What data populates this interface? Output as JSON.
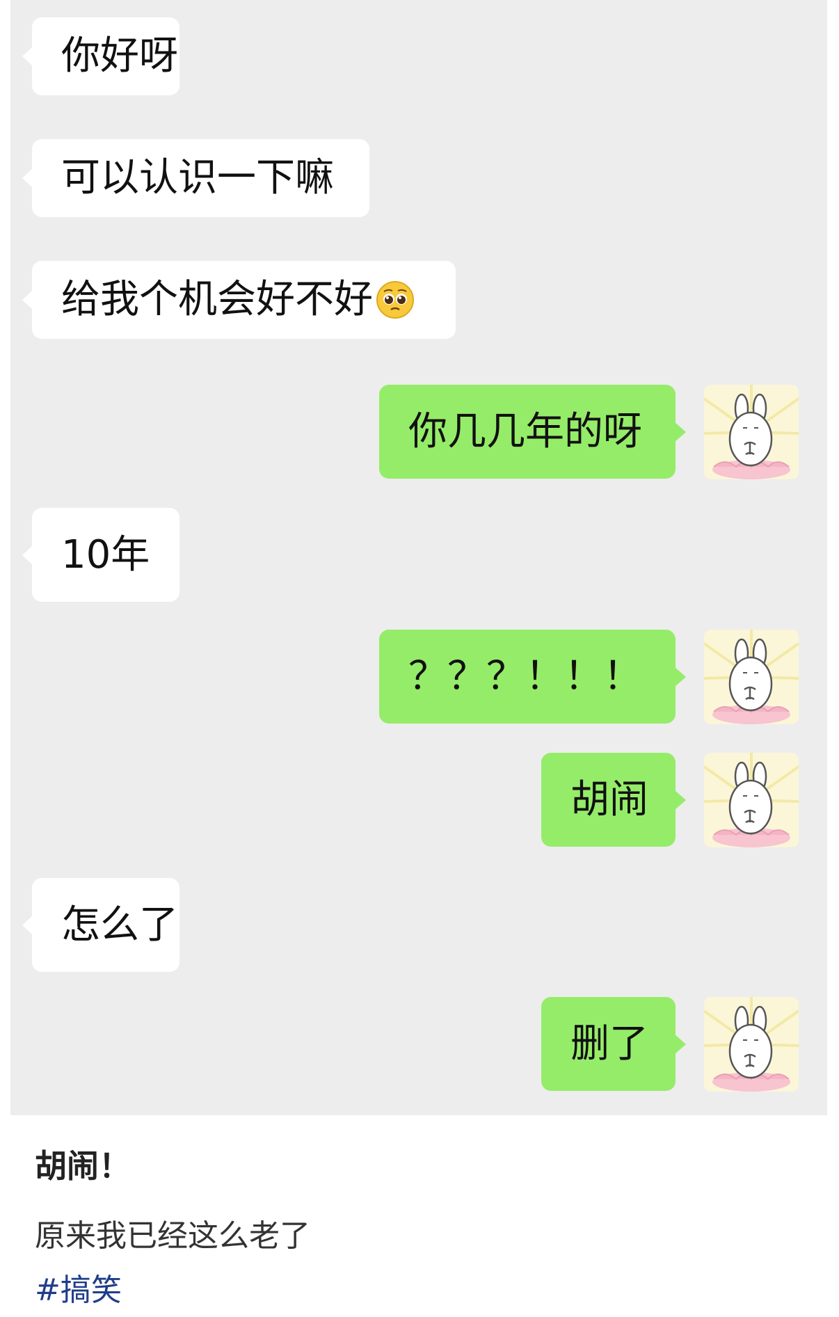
{
  "chat": {
    "messages": [
      {
        "side": "incoming",
        "text": "你好呀"
      },
      {
        "side": "incoming",
        "text": "可以认识一下嘛"
      },
      {
        "side": "incoming",
        "text": "给我个机会好不好",
        "emoji": "pleading-face-emoji"
      },
      {
        "side": "outgoing",
        "text": "你几几年的呀",
        "avatar": "bunny-avatar"
      },
      {
        "side": "incoming",
        "text": "10年"
      },
      {
        "side": "outgoing",
        "text": "？？？！！！",
        "avatar": "bunny-avatar"
      },
      {
        "side": "outgoing",
        "text": "胡闹",
        "avatar": "bunny-avatar"
      },
      {
        "side": "incoming",
        "text": "怎么了"
      },
      {
        "side": "outgoing",
        "text": "删了",
        "avatar": "bunny-avatar"
      }
    ]
  },
  "post": {
    "title": "胡闹！",
    "body": "原来我已经这么老了",
    "tag": "#搞笑"
  },
  "colors": {
    "chat_background": "#ededed",
    "incoming_bubble": "#ffffff",
    "outgoing_bubble": "#95ec69",
    "tag_link": "#1f3d8a"
  }
}
